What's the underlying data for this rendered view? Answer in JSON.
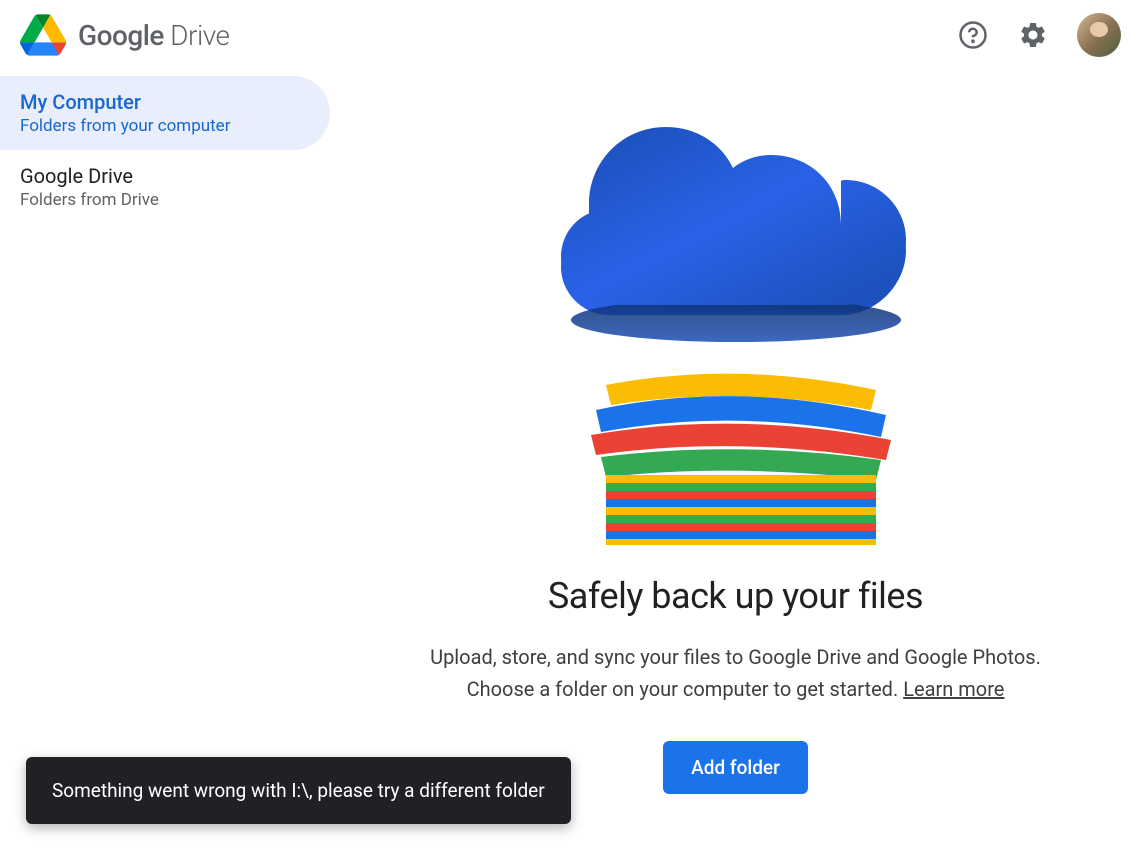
{
  "header": {
    "logo_bold": "Google",
    "logo_light": " Drive"
  },
  "sidebar": {
    "items": [
      {
        "title": "My Computer",
        "subtitle": "Folders from your computer",
        "active": true
      },
      {
        "title": "Google Drive",
        "subtitle": "Folders from Drive",
        "active": false
      }
    ]
  },
  "content": {
    "heading": "Safely back up your files",
    "description_line1": "Upload, store, and sync your files to Google Drive and Google Photos.",
    "description_line2_prefix": "Choose a folder on your computer to get started. ",
    "learn_more": "Learn more",
    "add_folder_button": "Add folder"
  },
  "toast": {
    "message": "Something went wrong with I:\\, please try a different folder"
  }
}
